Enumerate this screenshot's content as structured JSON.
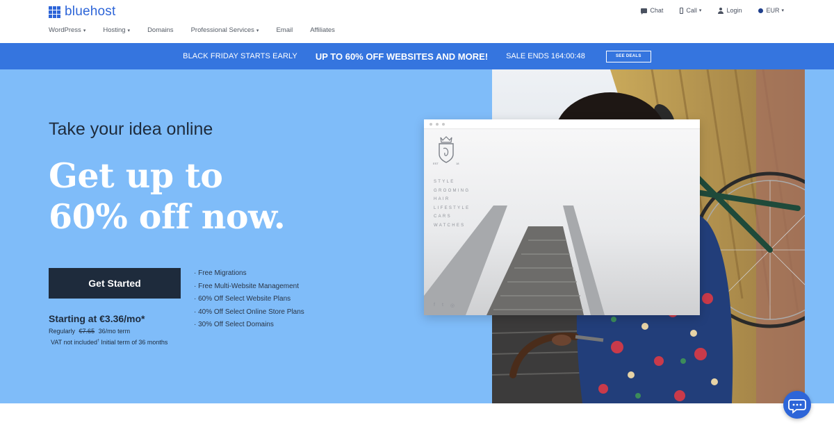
{
  "header": {
    "logo_text": "bluehost",
    "nav": [
      {
        "label": "WordPress",
        "dropdown": true
      },
      {
        "label": "Hosting",
        "dropdown": true
      },
      {
        "label": "Domains",
        "dropdown": false
      },
      {
        "label": "Professional Services",
        "dropdown": true
      },
      {
        "label": "Email",
        "dropdown": false
      },
      {
        "label": "Affiliates",
        "dropdown": false
      }
    ],
    "utils": {
      "chat": "Chat",
      "call": "Call",
      "login": "Login",
      "currency": "EUR"
    },
    "caret": "▾"
  },
  "promo": {
    "early": "BLACK FRIDAY STARTS EARLY",
    "main": "UP TO 60% OFF WEBSITES AND MORE!",
    "sale_ends": "SALE ENDS 164:00:48",
    "button": "SEE DEALS"
  },
  "hero": {
    "eyebrow": "Take your idea online",
    "headline_line1": "Get up to",
    "headline_line2": "60% off now.",
    "cta": "Get Started",
    "price": "Starting at €3.36/mo*",
    "regularly_label": "Regularly",
    "regular_price": "€7.65",
    "term": "36/mo term",
    "vat": "VAT not included",
    "vat_mark": "†",
    "initial_term": "Initial term of 36 months",
    "features": [
      "Free Migrations",
      "Free Multi-Website Management",
      "60% Off Select Website Plans",
      "40% Off Select Online Store Plans",
      "30% Off Select Domains"
    ]
  },
  "mock_site": {
    "menu": [
      "STYLE",
      "GROOMING",
      "HAIR",
      "LIFESTYLE",
      "CARS",
      "WATCHES"
    ],
    "logo_left": "EST",
    "logo_right": "18",
    "social": [
      "f",
      "t",
      "◎"
    ]
  },
  "colors": {
    "brand": "#2d65d8",
    "promo_bar": "#3575df",
    "hero_bg": "#7fbcf9",
    "dark_navy": "#1e2b3c"
  }
}
